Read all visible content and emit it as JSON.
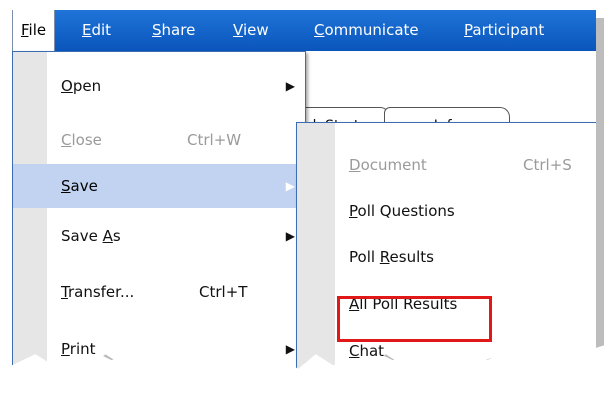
{
  "menubar": {
    "items": [
      {
        "label": "File",
        "accel": "F",
        "rest": "ile"
      },
      {
        "label": "Edit",
        "accel": "E",
        "rest": "dit"
      },
      {
        "label": "Share",
        "accel": "S",
        "rest": "hare"
      },
      {
        "label": "View",
        "accel": "V",
        "rest": "iew"
      },
      {
        "label": "Communicate",
        "accel": "C",
        "rest": "ommunicate"
      },
      {
        "label": "Participant",
        "accel": "P",
        "rest": "articipant"
      }
    ]
  },
  "tabs": {
    "quick_start": "k Start",
    "info": "Info"
  },
  "file_menu": {
    "items": [
      {
        "pre": "",
        "accel": "O",
        "post": "pen",
        "shortcut": "",
        "submenu": true,
        "enabled": true
      },
      {
        "pre": "",
        "accel": "C",
        "post": "lose",
        "shortcut": "Ctrl+W",
        "submenu": false,
        "enabled": false
      },
      {
        "pre": "",
        "accel": "S",
        "post": "ave",
        "shortcut": "",
        "submenu": true,
        "enabled": true
      },
      {
        "pre": "Save ",
        "accel": "A",
        "post": "s",
        "shortcut": "",
        "submenu": true,
        "enabled": true
      },
      {
        "pre": "",
        "accel": "T",
        "post": "ransfer...",
        "shortcut": "Ctrl+T",
        "submenu": false,
        "enabled": true
      },
      {
        "pre": "",
        "accel": "P",
        "post": "rint",
        "shortcut": "",
        "submenu": true,
        "enabled": true
      }
    ]
  },
  "save_submenu": {
    "items": [
      {
        "pre": "",
        "accel": "D",
        "post": "ocument",
        "shortcut": "Ctrl+S",
        "enabled": false
      },
      {
        "pre": "",
        "accel": "P",
        "post": "oll Questions",
        "shortcut": "",
        "enabled": true
      },
      {
        "pre": "Poll ",
        "accel": "R",
        "post": "esults",
        "shortcut": "",
        "enabled": true
      },
      {
        "pre": "",
        "accel": "A",
        "post": "ll Poll Results",
        "shortcut": "",
        "enabled": true
      },
      {
        "pre": "",
        "accel": "C",
        "post": "hat",
        "shortcut": "",
        "enabled": true
      }
    ]
  },
  "colors": {
    "menubar": "#0a55bb",
    "highlight_row": "#c1d3f0",
    "callout_box": "#e01818"
  }
}
